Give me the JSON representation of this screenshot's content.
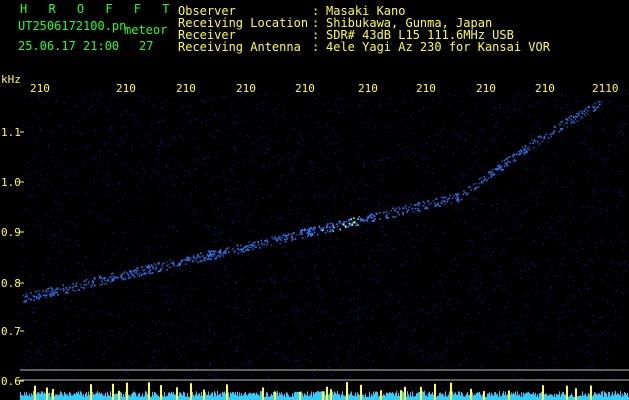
{
  "header": {
    "title": "H R O F F T",
    "filename": "UT2506172100.pn",
    "event_type": "meteor",
    "datetime": "25.06.17 21:00",
    "count": "27",
    "observer_label": "Observer",
    "observer_value": "Masaki Kano",
    "location_label": "Receiving Location",
    "location_value": "Shibukawa, Gunma, Japan",
    "receiver_label": "Receiver",
    "receiver_value": "SDR# 43dB L15 111.6MHz USB",
    "antenna_label": "Receiving Antenna",
    "antenna_value": "4ele Yagi Az 230 for Kansai VOR",
    "colon": ":"
  },
  "axes": {
    "y_unit": "kHz",
    "y_ticks": [
      "1.1",
      "1.0",
      "0.9",
      "0.8",
      "0.7",
      "0.6"
    ],
    "x_ticks": [
      "210",
      "210",
      "210",
      "210",
      "210",
      "210",
      "210",
      "210",
      "210",
      "2110"
    ]
  },
  "colors": {
    "header_text": "#22ff22",
    "tick_text": "#ffff33",
    "noise": "#0a1a8c",
    "trail": "#3a7cff",
    "spectrum_bar": "#33ccff",
    "spectrum_peak": "#ffff33"
  }
}
